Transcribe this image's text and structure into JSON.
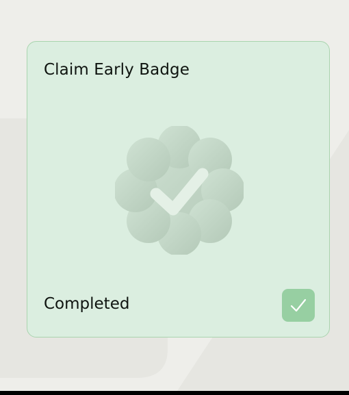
{
  "card": {
    "title": "Claim Early Badge",
    "status": "Completed",
    "badge_icon": "verified-badge-icon",
    "status_icon": "checkmark-icon",
    "colors": {
      "card_background": "#dbeee0",
      "card_border": "#a9d4ae",
      "status_check_background": "#97cfa2",
      "text": "#0f1410"
    }
  }
}
